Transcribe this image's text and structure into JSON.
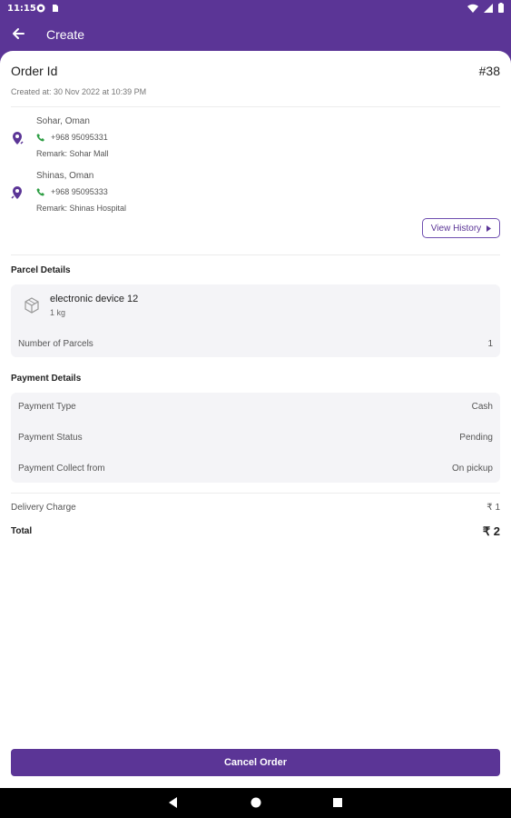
{
  "status_bar": {
    "time": "11:15"
  },
  "app_bar": {
    "title": "Create"
  },
  "order": {
    "label": "Order Id",
    "number": "#38",
    "created_at": "Created at:  30 Nov 2022 at 10:39 PM"
  },
  "pickup": {
    "city": "Sohar, Oman",
    "phone": "+968 95095331",
    "remark": "Remark: Sohar Mall"
  },
  "dropoff": {
    "city": "Shinas, Oman",
    "phone": "+968 95095333",
    "remark": "Remark: Shinas Hospital"
  },
  "view_history_label": "View History",
  "parcel": {
    "section_title": "Parcel Details",
    "item_name": "electronic device 12",
    "item_weight": "1 kg",
    "count_label": "Number of Parcels",
    "count_value": "1"
  },
  "payment": {
    "section_title": "Payment Details",
    "rows": [
      {
        "label": "Payment Type",
        "value": "Cash"
      },
      {
        "label": "Payment Status",
        "value": "Pending"
      },
      {
        "label": "Payment Collect from",
        "value": "On pickup"
      }
    ]
  },
  "charges": {
    "delivery_label": "Delivery Charge",
    "delivery_value": "₹ 1",
    "total_label": "Total",
    "total_value": "₹ 2"
  },
  "cancel_label": "Cancel Order",
  "colors": {
    "primary": "#5b3596",
    "phone_green": "#2e9e44",
    "card_bg": "#f4f4f7"
  }
}
